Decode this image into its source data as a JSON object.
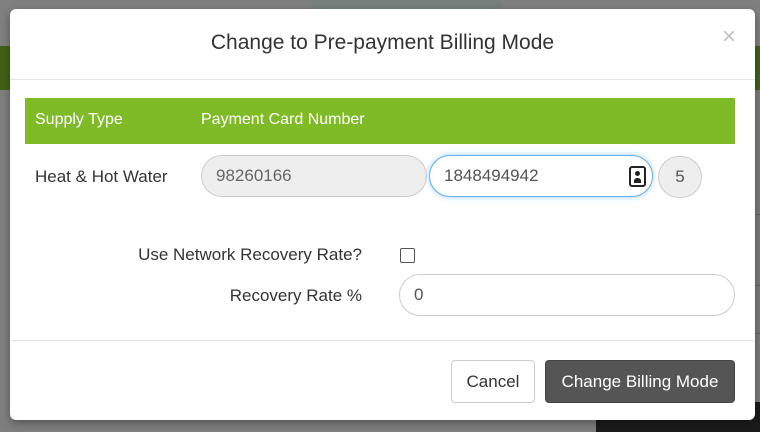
{
  "modal": {
    "title": "Change to Pre-payment Billing Mode",
    "close_glyph": "×"
  },
  "table": {
    "headers": {
      "supply_type": "Supply Type",
      "payment_card_number": "Payment Card Number"
    },
    "row": {
      "supply_type": "Heat & Hot Water",
      "card_prefix": "98260166",
      "card_number": "1848494942",
      "card_count": "5"
    }
  },
  "recovery": {
    "network_label": "Use Network Recovery Rate?",
    "network_checked": false,
    "rate_label": "Recovery Rate %",
    "rate_value": "0"
  },
  "footer": {
    "cancel_label": "Cancel",
    "submit_label": "Change Billing Mode"
  },
  "colors": {
    "header_green": "#7fba27",
    "primary_button": "#555555",
    "focus_border": "#66afe9"
  },
  "icons": {
    "card_badge": "id-badge-icon",
    "close": "close-icon"
  }
}
